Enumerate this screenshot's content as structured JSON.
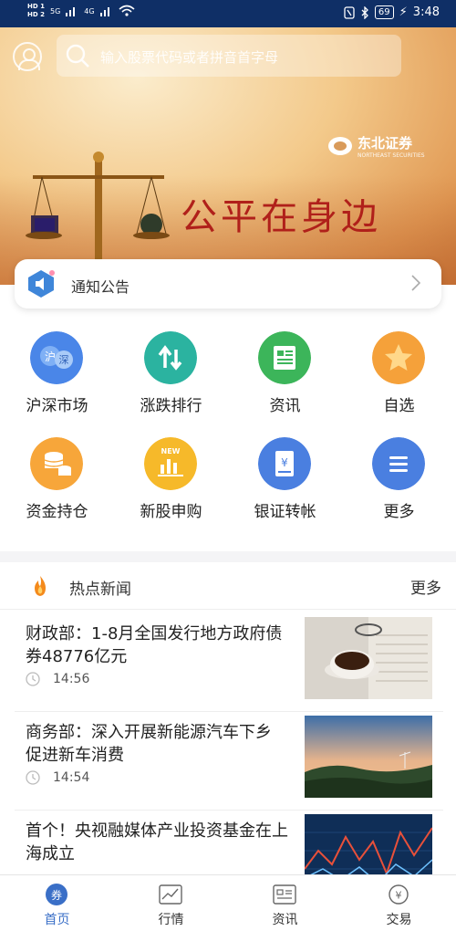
{
  "status_bar": {
    "hd1": "HD 1",
    "hd2": "HD 2",
    "net1": "5G",
    "net2": "4G",
    "battery": "69",
    "time": "3:48"
  },
  "header": {
    "search_placeholder": "输入股票代码或者拼音首字母"
  },
  "banner": {
    "brand_name": "东北证券",
    "brand_sub": "NORTHEAST SECURITIES",
    "slogan": "公平在身边"
  },
  "notice": {
    "label": "通知公告"
  },
  "quick_menu": [
    {
      "label": "沪深市场",
      "icon": "shanghai-shenzhen-icon",
      "color": "#4a86e8"
    },
    {
      "label": "涨跌排行",
      "icon": "up-down-arrows-icon",
      "color": "#2bb3a0"
    },
    {
      "label": "资讯",
      "icon": "newspaper-icon",
      "color": "#3cb55a"
    },
    {
      "label": "自选",
      "icon": "star-icon",
      "color": "#f5a13a"
    },
    {
      "label": "资金持仓",
      "icon": "coins-icon",
      "color": "#f7a63a"
    },
    {
      "label": "新股申购",
      "icon": "new-stock-icon",
      "color": "#f6b92a"
    },
    {
      "label": "银证转帐",
      "icon": "bank-transfer-icon",
      "color": "#4a7fe0"
    },
    {
      "label": "更多",
      "icon": "menu-icon",
      "color": "#4a7fe0"
    }
  ],
  "news": {
    "title": "热点新闻",
    "more": "更多",
    "items": [
      {
        "title": "财政部：1-8月全国发行地方政府债券48776亿元",
        "time": "14:56"
      },
      {
        "title": "商务部：深入开展新能源汽车下乡 促进新车消费",
        "time": "14:54"
      },
      {
        "title": "首个！央视融媒体产业投资基金在上海成立",
        "time": ""
      }
    ]
  },
  "bottom_nav": [
    {
      "label": "首页",
      "active": true,
      "icon": "home-icon"
    },
    {
      "label": "行情",
      "active": false,
      "icon": "chart-icon"
    },
    {
      "label": "资讯",
      "active": false,
      "icon": "news-icon"
    },
    {
      "label": "交易",
      "active": false,
      "icon": "yuan-icon"
    }
  ]
}
